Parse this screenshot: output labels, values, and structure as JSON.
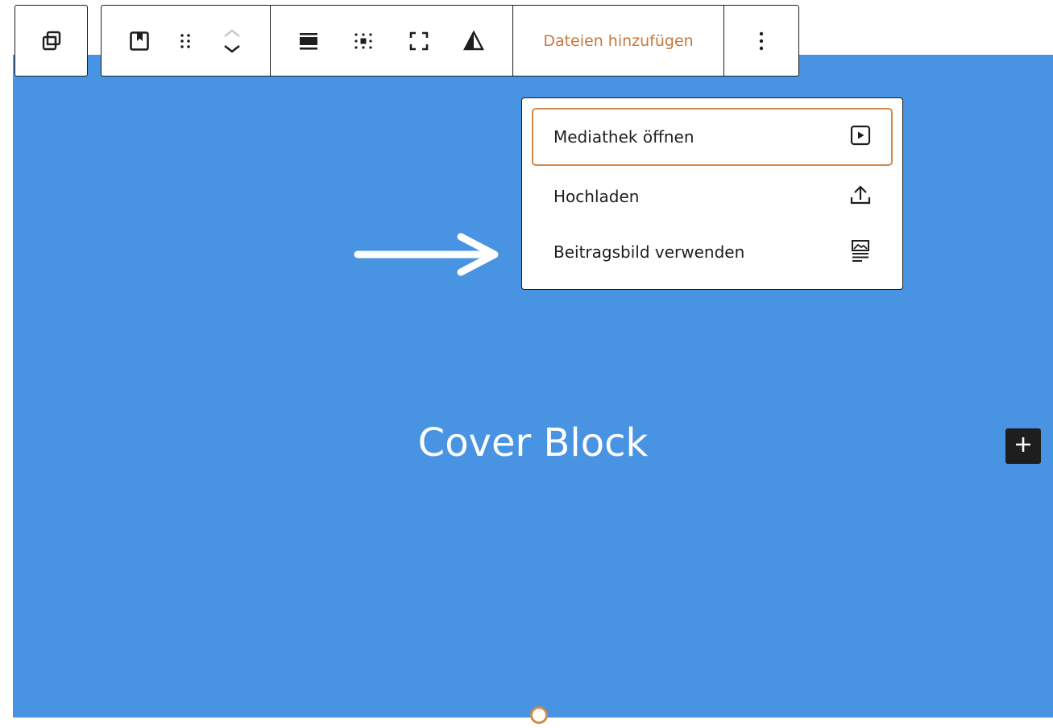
{
  "cover": {
    "title": "Cover Block",
    "background_color": "#4994e2"
  },
  "toolbar": {
    "icons": [
      "duplicate-icon",
      "cover-block-icon",
      "drag-handle-icon",
      "move-up-icon",
      "move-down-icon",
      "align-icon",
      "content-position-icon",
      "full-height-icon",
      "contrast-icon",
      "more-options-icon"
    ],
    "add_files_label": "Dateien hinzufügen",
    "accent_color": "#c8773c"
  },
  "media_menu": {
    "items": [
      {
        "label": "Mediathek öffnen",
        "icon": "media-library-icon",
        "active": true
      },
      {
        "label": "Hochladen",
        "icon": "upload-icon",
        "active": false
      },
      {
        "label": "Beitragsbild verwenden",
        "icon": "featured-image-icon",
        "active": false
      }
    ]
  },
  "inserter": {
    "icon": "plus-icon"
  },
  "annotation": {
    "icon": "arrow-right-icon"
  }
}
